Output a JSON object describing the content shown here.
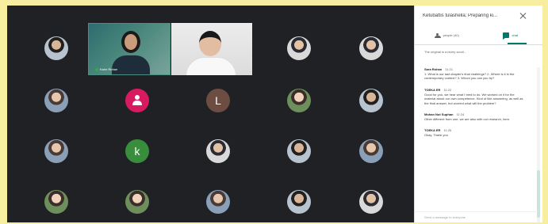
{
  "panel": {
    "title": "Ketubattis tulashella; Preparing ki...",
    "tabs": [
      {
        "label": "people (40)",
        "icon": "people-icon",
        "active": false
      },
      {
        "label": "chat",
        "icon": "chat-icon",
        "active": true
      }
    ],
    "notice": "The original is a blurry scroll...",
    "messages": [
      {
        "sender": "Sara Rohan",
        "time": "11:21",
        "text": "1. What is our last chapter's final challenge?\n2. Where is it in the contemporary context?\n3. Whom you can you try?"
      },
      {
        "sender": "TOEKA ER",
        "time": "11:22",
        "text": "Good for you, we hear what I tried to do. We worked on it for the material about our own competence. Kind of like answering, as well as the final answer, but worried what will the problem?"
      },
      {
        "sender": "Mohan Nut Suphan",
        "time": "11:24",
        "text": "Other different from one, we are also with our research, here."
      },
      {
        "sender": "TOEKA ER",
        "time": "11:26",
        "text": "Okay, Thank you"
      }
    ],
    "composer_placeholder": "Send a message to everyone"
  },
  "videos": [
    {
      "name": "Karin Rohan",
      "mic": "on"
    },
    {
      "name": "",
      "mic": "on"
    }
  ],
  "avatars": [
    {
      "kind": "photo",
      "variant": "alt1"
    },
    {
      "kind": "photo",
      "variant": "alt3"
    },
    {
      "kind": "photo",
      "variant": "alt3"
    },
    {
      "kind": "photo",
      "variant": ""
    },
    {
      "kind": "generic",
      "letter": ""
    },
    {
      "kind": "letter",
      "letter": "L"
    },
    {
      "kind": "photo",
      "variant": "alt2"
    },
    {
      "kind": "photo",
      "variant": "alt1"
    },
    {
      "kind": "photo",
      "variant": ""
    },
    {
      "kind": "letter",
      "letter": "k"
    },
    {
      "kind": "photo",
      "variant": "alt3"
    },
    {
      "kind": "photo",
      "variant": "alt1"
    },
    {
      "kind": "photo",
      "variant": ""
    },
    {
      "kind": "photo",
      "variant": "alt2"
    },
    {
      "kind": "photo",
      "variant": "alt2"
    },
    {
      "kind": "photo",
      "variant": ""
    },
    {
      "kind": "photo",
      "variant": "alt1"
    },
    {
      "kind": "photo",
      "variant": "alt3"
    },
    {
      "kind": "photo",
      "variant": ""
    },
    {
      "kind": "photo",
      "variant": "alt1"
    },
    {
      "kind": "photo",
      "variant": "alt2"
    },
    {
      "kind": "photo",
      "variant": "alt1"
    }
  ]
}
